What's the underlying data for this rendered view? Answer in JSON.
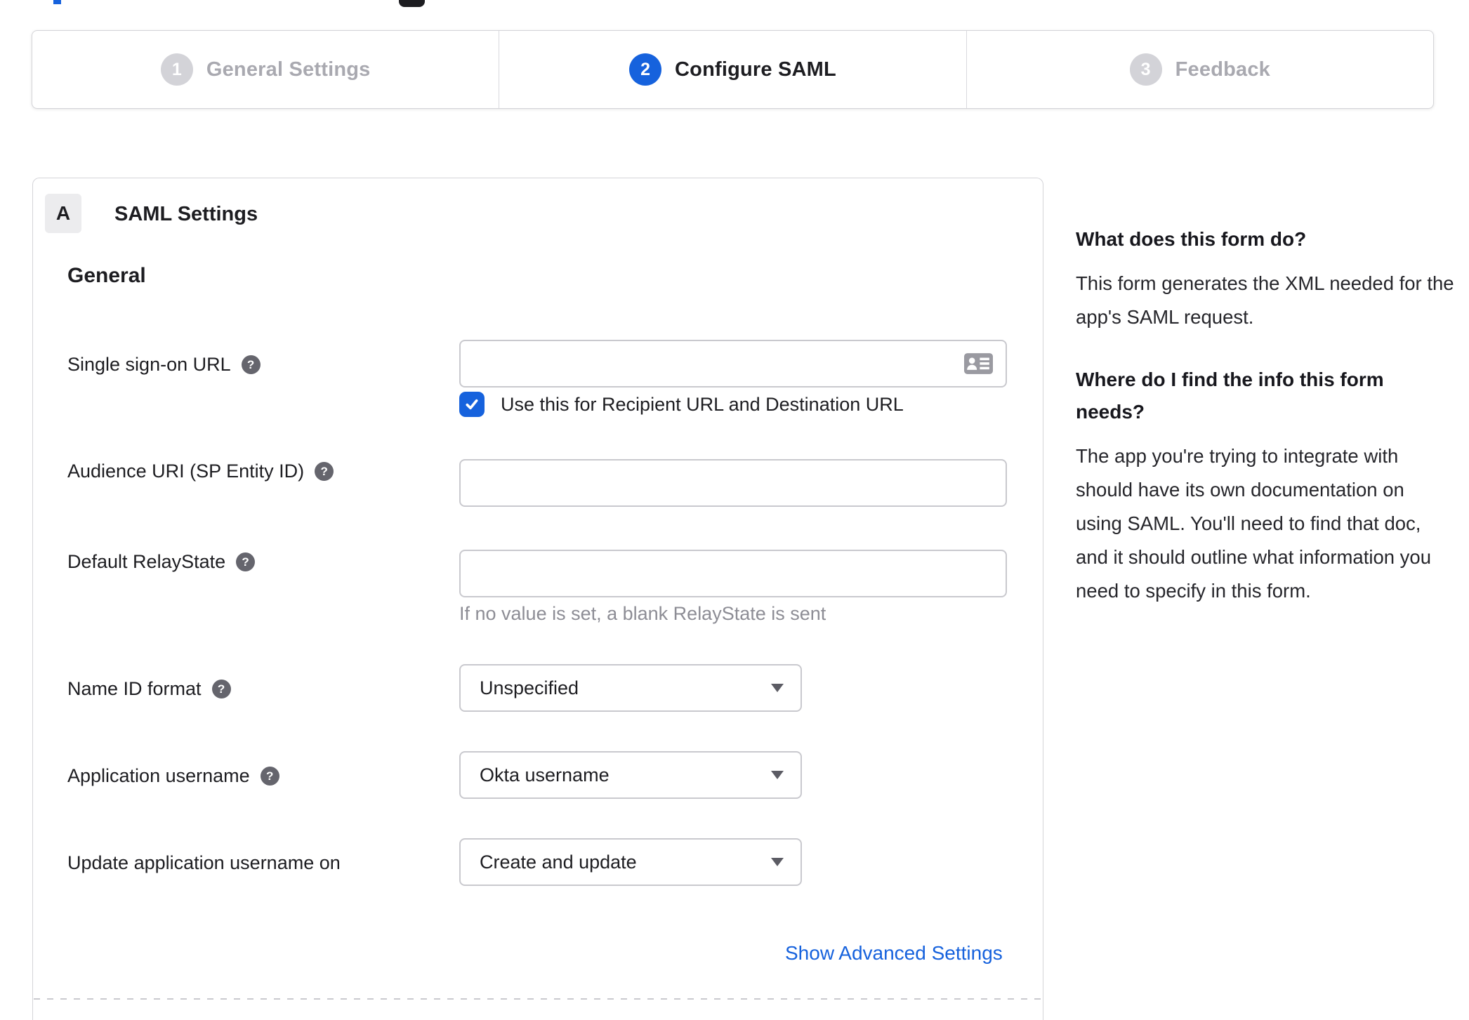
{
  "stepper": {
    "steps": [
      {
        "number": "1",
        "label": "General Settings",
        "state": "inactive"
      },
      {
        "number": "2",
        "label": "Configure SAML",
        "state": "active"
      },
      {
        "number": "3",
        "label": "Feedback",
        "state": "inactive"
      }
    ]
  },
  "saml_panel": {
    "badge": "A",
    "title": "SAML Settings",
    "section_heading": "General",
    "help_icon_glyph": "?",
    "fields": [
      {
        "label": "Single sign-on URL",
        "value": "",
        "checkbox_checked": true,
        "checkbox_label": "Use this for Recipient URL and Destination URL"
      },
      {
        "label": "Audience URI (SP Entity ID)",
        "value": ""
      },
      {
        "label": "Default RelayState",
        "value": "",
        "hint": "If no value is set, a blank RelayState is sent"
      },
      {
        "label": "Name ID format",
        "value": "Unspecified"
      },
      {
        "label": "Application username",
        "value": "Okta username"
      },
      {
        "label": "Update application username on",
        "value": "Create and update"
      }
    ],
    "advanced_settings_link": "Show Advanced Settings"
  },
  "help_panel": {
    "sections": [
      {
        "heading": "What does this form do?",
        "body": "This form generates the XML needed for the app's SAML request."
      },
      {
        "heading": "Where do I find the info this form needs?",
        "body": "The app you're trying to integrate with should have its own documentation on using SAML. You'll need to find that doc, and it should outline what information you need to specify in this form."
      }
    ]
  },
  "colors": {
    "accent_blue": "#1662dd",
    "inactive_circle_gray": "#d3d3d8",
    "text_dark": "#1d1d21",
    "border_gray": "#c9c9ce",
    "hint_gray": "#8d8d95"
  }
}
